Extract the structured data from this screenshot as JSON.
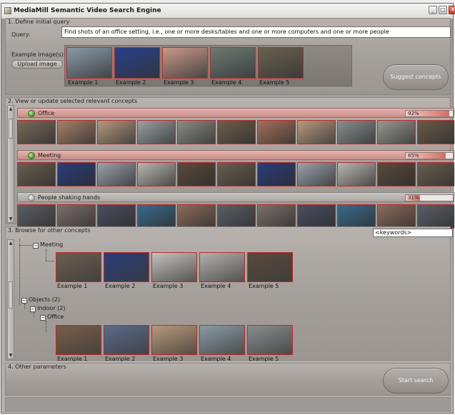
{
  "window": {
    "title": "MediaMill Semantic Video Search Engine",
    "minimize_glyph": "_",
    "maximize_glyph": "□",
    "close_glyph": "✕"
  },
  "section1": {
    "label": "1. Define initial query",
    "query_label": "Query:",
    "query_value": "Find shots of an office setting, i.e., one or more desks/tables and one or more computers and one or more people",
    "examples_label": "Example image(s):",
    "upload_button": "Upload image",
    "examples": [
      {
        "caption": "Example 1",
        "color": "#8a9aa8"
      },
      {
        "caption": "Example 2",
        "color": "#2a3f8a"
      },
      {
        "caption": "Example 3",
        "color": "#c89a8a"
      },
      {
        "caption": "Example 4",
        "color": "#6e7a74"
      },
      {
        "caption": "Example 5",
        "color": "#6a6150"
      }
    ],
    "suggest_button": "Suggest concepts"
  },
  "section2": {
    "label": "2. View or update selected relevant concepts",
    "concepts": [
      {
        "name": "Office",
        "confidence": 92,
        "confidence_text": "92%",
        "selected": true,
        "frames": [
          "#7a6a58",
          "#a48068",
          "#b4987e",
          "#9aa0a4",
          "#8c8c84",
          "#6e5e4c",
          "#a3705c",
          "#b89a80",
          "#8a8e90",
          "#9a9890",
          "#6a5a48"
        ]
      },
      {
        "name": "Meeting",
        "confidence": 85,
        "confidence_text": "85%",
        "selected": true,
        "frames": [
          "#6a5e50",
          "#2a3c78",
          "#9aa2ac",
          "#b8b6b0",
          "#5a4a3c",
          "#6a5e50",
          "#2a3c78",
          "#9aa2ac",
          "#b8b6b0",
          "#5a4a3c",
          "#6a5e50"
        ]
      },
      {
        "name": "People shaking hands",
        "confidence": 31,
        "confidence_text": "31%",
        "selected": false,
        "frames": [
          "#5a5e66",
          "#7a6e6a",
          "#4a4e60",
          "#3a6a8a",
          "#8a6a5a",
          "#5a5e66",
          "#7a6e6a",
          "#4a4e60",
          "#3a6a8a",
          "#8a6a5a",
          "#5a5e66"
        ]
      }
    ]
  },
  "section3": {
    "label": "3. Browse for other concepts",
    "keyword_value": "<keywords>",
    "tree": {
      "meeting": {
        "label": "Meeting",
        "examples": [
          {
            "caption": "Example 1",
            "color": "#6a5e50"
          },
          {
            "caption": "Example 2",
            "color": "#2a3c78"
          },
          {
            "caption": "Example 3",
            "color": "#c4c2bc"
          },
          {
            "caption": "Example 4",
            "color": "#b2b0aa"
          },
          {
            "caption": "Example 5",
            "color": "#5a4a3c"
          }
        ]
      },
      "objects": "Objects (2)",
      "indoor": "Indoor (2)",
      "office": {
        "label": "Office",
        "examples": [
          {
            "caption": "Example 1",
            "color": "#7a5e48"
          },
          {
            "caption": "Example 2",
            "color": "#5a6a8a"
          },
          {
            "caption": "Example 3",
            "color": "#b8987a"
          },
          {
            "caption": "Example 4",
            "color": "#8a9aa4"
          },
          {
            "caption": "Example 5",
            "color": "#8a8c8e"
          }
        ]
      }
    }
  },
  "section4": {
    "label": "4. Other parameters",
    "start_button": "Start search"
  }
}
